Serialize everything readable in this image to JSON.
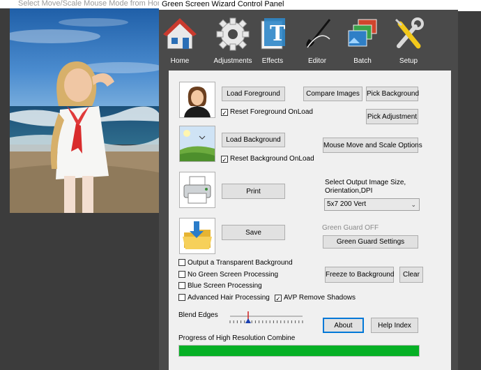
{
  "photo_window": {
    "title": "Select Move/Scale Mouse Mode from Home"
  },
  "panel": {
    "title": "Green Screen Wizard Control Panel",
    "toolbar": [
      {
        "label": "Home",
        "icon": "house-icon"
      },
      {
        "label": "Adjustments",
        "icon": "gear-icon"
      },
      {
        "label": "Effects",
        "icon": "text-effects-icon"
      },
      {
        "label": "Editor",
        "icon": "brush-icon"
      },
      {
        "label": "Batch",
        "icon": "stacked-images-icon"
      },
      {
        "label": "Setup",
        "icon": "wrench-screwdriver-icon"
      }
    ],
    "buttons": {
      "load_foreground": "Load Foreground",
      "compare_images": "Compare Images",
      "pick_background": "Pick Background",
      "pick_adjustment": "Pick Adjustment",
      "load_background": "Load Background",
      "mouse_move_scale": "Mouse Move and Scale Options",
      "print": "Print",
      "save": "Save",
      "green_guard_settings": "Green Guard Settings",
      "freeze_to_background": "Freeze to Background",
      "clear": "Clear",
      "about": "About",
      "help_index": "Help Index"
    },
    "checkboxes": {
      "reset_foreground": {
        "label": "Reset Foreground OnLoad",
        "checked": true
      },
      "reset_background": {
        "label": "Reset Background OnLoad",
        "checked": true
      },
      "transparent_bg": {
        "label": "Output a Transparent Background",
        "checked": false
      },
      "no_green": {
        "label": "No Green Screen Processing",
        "checked": false
      },
      "blue_screen": {
        "label": "Blue Screen Processing",
        "checked": false
      },
      "advanced_hair": {
        "label": "Advanced Hair Processing",
        "checked": false
      },
      "avp_shadows": {
        "label": "AVP Remove Shadows",
        "checked": true
      }
    },
    "output_size": {
      "label": "Select Output Image Size, Orientation,DPI",
      "selected": "5x7 200 Vert"
    },
    "green_guard_status": "Green Guard OFF",
    "blend_edges": {
      "label": "Blend Edges",
      "value": 0.25
    },
    "progress": {
      "label": "Progress of High Resolution Combine",
      "value": 1.0
    },
    "colors": {
      "progress": "#06b025",
      "focus": "#0078d7"
    }
  }
}
